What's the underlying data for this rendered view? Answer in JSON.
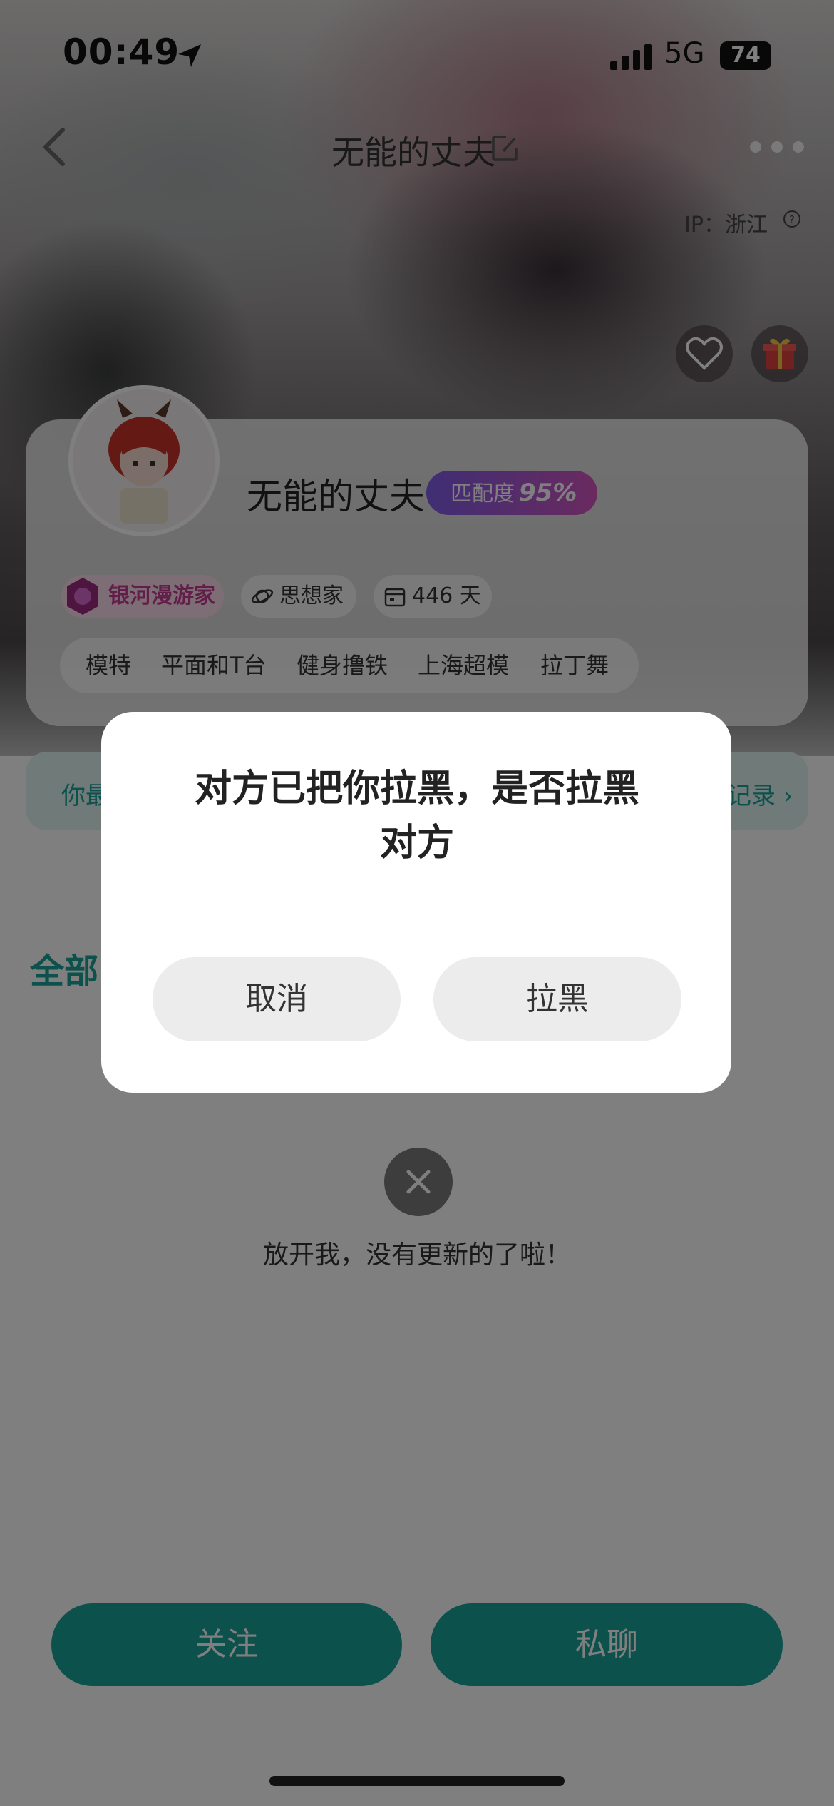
{
  "status_bar": {
    "time": "00:49",
    "network": "5G",
    "battery": "74"
  },
  "nav": {
    "title": "无能的丈夫"
  },
  "ip": {
    "label": "IP：浙江"
  },
  "profile": {
    "username": "无能的丈夫",
    "match_label": "匹配度",
    "match_value": "95%",
    "badges": {
      "galaxy": "银河漫游家",
      "thinker": "思想家",
      "days": "446 天"
    },
    "interests": [
      "模特",
      "平面和T台",
      "健身撸铁",
      "上海超模",
      "拉丁舞"
    ]
  },
  "banner": {
    "left_text": "你最",
    "right_text": "记录 ›"
  },
  "tabs": {
    "all": "全部"
  },
  "empty_state": {
    "text": "放开我，没有更新的了啦！"
  },
  "bottom_actions": {
    "follow": "关注",
    "chat": "私聊"
  },
  "dialog": {
    "message_line1": "对方已把你拉黑，是否拉黑",
    "message_line2": "对方",
    "cancel": "取消",
    "block": "拉黑"
  },
  "colors": {
    "accent": "#1ba39a",
    "match_gradient_start": "#7f5ce8",
    "match_gradient_end": "#d455c0"
  }
}
